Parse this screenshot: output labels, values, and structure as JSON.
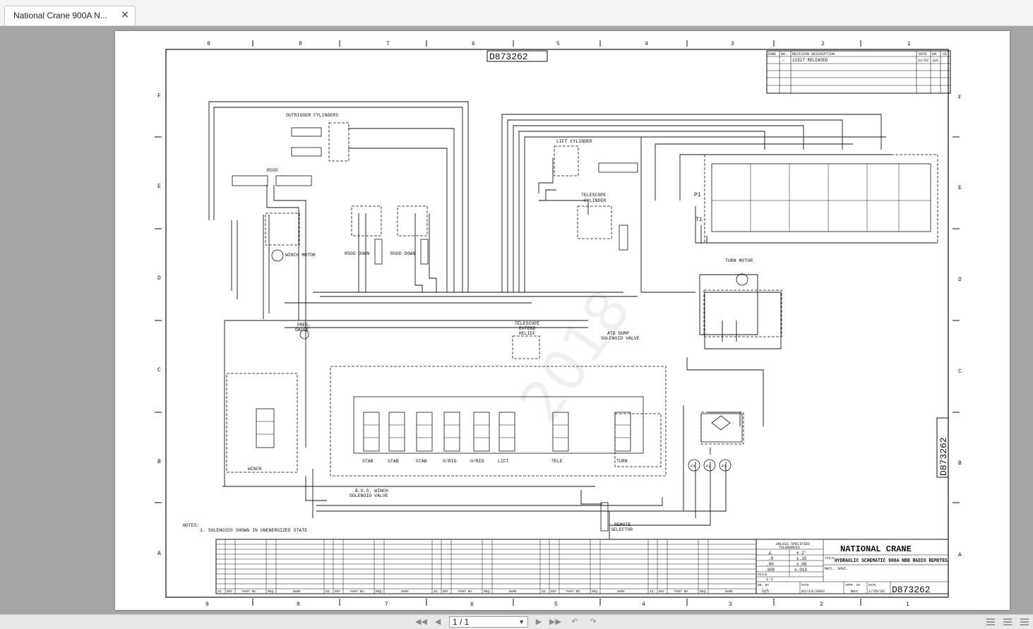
{
  "tab": {
    "title": "National Crane 900A N...",
    "close": "×"
  },
  "drawing": {
    "number": "D873262",
    "title_company": "NATIONAL CRANE",
    "title_label": "TITLE",
    "title_text": "HYDRAULIC SCHEMATIC 900A NBB RADIO REMOTES",
    "matl_spec": "MATL. SPEC.",
    "watermark": "2018",
    "zones_top": [
      "9",
      "8",
      "7",
      "6",
      "5",
      "4",
      "3",
      "2",
      "1"
    ],
    "zones_side": [
      "F",
      "E",
      "D",
      "C",
      "B",
      "A"
    ],
    "revision": {
      "headers": [
        "ZONE",
        "NO.",
        "REVISION DESCRIPTION",
        "DATE",
        "DR",
        "CK"
      ],
      "row": [
        "",
        "—",
        "11527 RELEASED",
        "11/02",
        "JyS",
        ""
      ]
    },
    "labels": {
      "outrigger": "OUTRIGGER CYLINDERS",
      "rsod": "RSOD",
      "rsod_down": "RSOD DOWN",
      "winch_motor": "WINCH MOTOR",
      "lift_cylinder": "LIFT CYLINDER",
      "telescope_cylinder_1": "TELESCOPE",
      "telescope_cylinder_2": "CYLINDER",
      "turn_motor": "TURN MOTOR",
      "pres_gauge_1": "PRES.",
      "pres_gauge_2": "GAUGE",
      "tele_relief_1": "TELESCOPE",
      "tele_relief_2": "EXTEND",
      "tele_relief_3": "RELIEF",
      "atb_1": "ATB DUMP",
      "atb_2": "SOLENOID VALVE",
      "bos_1": "B.O.S. WINCH",
      "bos_2": "SOLENOID VALVE",
      "remote_1": "REMOTE",
      "remote_2": "SELECTOR",
      "p1": "P1",
      "t1": "T1",
      "winch": "WINCH",
      "sections": [
        "STAB",
        "STAB",
        "STAB",
        "O/RIG",
        "O/RIG",
        "LIFT",
        "TELE",
        "TURN"
      ],
      "pumps": [
        "P3",
        "P2",
        "P1"
      ]
    },
    "notes": {
      "header": "NOTES:",
      "line1": "1. SOLENOIDS SHOWN IN UNENERGIZED STATE"
    },
    "parts_headers": [
      "SZ.",
      "REF",
      "PART NO.",
      "REQ.",
      "NAME"
    ],
    "tolerances": {
      "title1": "UNLESS SPECIFIED",
      "title2": "TOLERANCES",
      "rows": [
        [
          "∠",
          "± 2°"
        ],
        [
          ".0",
          "±.25"
        ],
        [
          ".00",
          "±.06"
        ],
        [
          ".000",
          "±.010"
        ]
      ],
      "scale_label": "SCALE",
      "scale": "1:1"
    },
    "signoff": {
      "dr_by_label": "DR. BY",
      "dr_by": "JyS",
      "date_label": "DATE",
      "date": "01/13/2002",
      "appr_by_label": "APPR. BY",
      "appr_by": "Ben",
      "date2_label": "DATE",
      "date2": "1/29/02"
    }
  },
  "statusbar": {
    "page_indicator": "1 / 1",
    "nav": [
      "first-page-icon",
      "prev-page-icon",
      "next-page-icon",
      "last-page-icon",
      "back-icon",
      "forward-icon"
    ]
  },
  "colors": {
    "viewer_bg": "#a6a6a6",
    "ink": "#111111",
    "page": "#ffffff"
  }
}
